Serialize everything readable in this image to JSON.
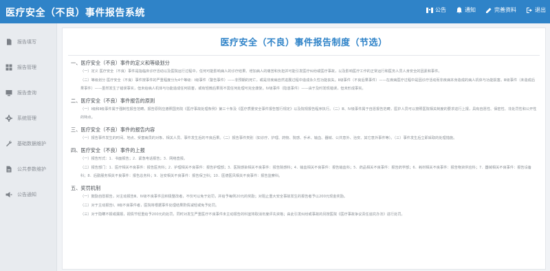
{
  "app": {
    "title": "医疗安全（不良）事件报告系统"
  },
  "topbar": {
    "actions": [
      {
        "label": "公告",
        "icon": "announcement-icon"
      },
      {
        "label": "通知",
        "icon": "bell-icon"
      },
      {
        "label": "完善资料",
        "icon": "edit-icon"
      },
      {
        "label": "退出",
        "icon": "logout-icon"
      }
    ]
  },
  "sidebar": {
    "items": [
      {
        "label": "报告填写",
        "icon": "document-icon"
      },
      {
        "label": "报告管理",
        "icon": "grid-icon"
      },
      {
        "label": "报告查询",
        "icon": "monitor-icon"
      },
      {
        "label": "系统管理",
        "icon": "gear-icon"
      },
      {
        "label": "基础数据维护",
        "icon": "wrench-icon"
      },
      {
        "label": "公共参数维护",
        "icon": "file-icon"
      },
      {
        "label": "公告通知",
        "icon": "speaker-icon"
      }
    ]
  },
  "document": {
    "title": "医疗安全（不良）事件报告制度（节选）",
    "s1_title": "一、医疗安全（不良）事件的定义和等级划分",
    "s1_p1": "（一）定义 医疗安全（不良）事件是指临床诊疗活动以及医院运行过程中，任何可能影响病人的诊疗结果、增加病人的痛苦和负担并可能引发医疗纠纷或医疗事故，以及影响医疗工作的正常运行和医务人员人身安全的因素和事件。",
    "s1_p2": "（二）等级划分 医疗安全（不良）事件按事件的严重程度分为4个等级：Ⅰ级事件（警告事件）——非预期的死亡，或是非疾病自然进展过程中造成永久性功能丧失。Ⅱ级事件（不良后果事件）——在疾病医疗过程中是因诊疗活动而非疾病本身造成的病人机体与功能损害。Ⅲ级事件（未造成后果事件）——虽然发生了错误事实，但未给病人机体与功能造成任何损害，或有轻微后果而不需任何处理可完全康复。Ⅳ级事件（隐患事件）——由于及时发现错误，但未形成事实。",
    "s2_title": "二、医疗安全（不良）事件报告的原则",
    "s2_p1": "（一）Ⅰ级和Ⅱ级事件属于强制性报告范畴，报告原则应遵照国务院《医疗事故处理条例》第三十条及《医疗质量安全事件报告暂行规定》以及院规报告程序执行。（二）Ⅲ、Ⅳ级事件属于自愿报告范畴，医护人员可以按照医院相关制度的要求进行上报，具有自愿性、保密性、非处罚性和公开性的特点。",
    "s3_title": "三、医疗安全（不良）事件的报告内容",
    "s3_p1": "（一）报告事件发生的时间、地点、受害病员的对象、相关人员、事件发生后的不良后果。（二）报告事件类别（如诊疗、护理、药物、院感、手术、输血、器械、公共意外、治安、其它意外事件等）。（三）事件发生后立即采取的处理措施。",
    "s4_title": "四、医疗安全（不良）事件的上报",
    "s4_p1": "（一）报告形式：1．书面报告；2．紧急电话报告；3．网络直报。",
    "s4_p2": "（二）报告部门：1．医疗相关不良事件：报告医务科；2．护理相关不良事件：报告护理部；3．医院感染相关不良事件：报告院感科；4．输血相关不良事件：报告输血科；5．药品相关不良事件：报告药学部；6．耗材相关不良事件：报告物资供应科；7．器械相关不良事件：报告设备科；8．后勤服务相关不良事件：报告总务科；9．治安相关不良事件：报告保卫科；10．医德医风相关不良事件：报告监察科。",
    "s5_title": "五、奖罚机制",
    "s5_p1": "（一）鼓励自愿报告，对主动报告Ⅲ、Ⅳ级不良事件且积极整改者，不仅可以免于处罚，并给予每例20元的奖励；对阻止重大安全事故发生的报告者予以200元现金奖励。",
    "s5_p2": "（二）对于主动报告Ⅰ、Ⅱ级不良事件者，医院将根据事件处理结果酌情减轻或免予处罚。",
    "s5_p3": "（三）对于隐瞒不报或漏报，视情节轻重给予200元的处罚，同时对发生严重医疗不良事件未主动报告的科室将取消年度评先资格；由此引发纠纷或事故的另按医院《医疗事故争议责任追究办法》进行处罚。"
  },
  "colors": {
    "brand": "#2f83c8",
    "sidebar_bg": "#e8ebef",
    "page_bg": "#f1f3f6"
  }
}
